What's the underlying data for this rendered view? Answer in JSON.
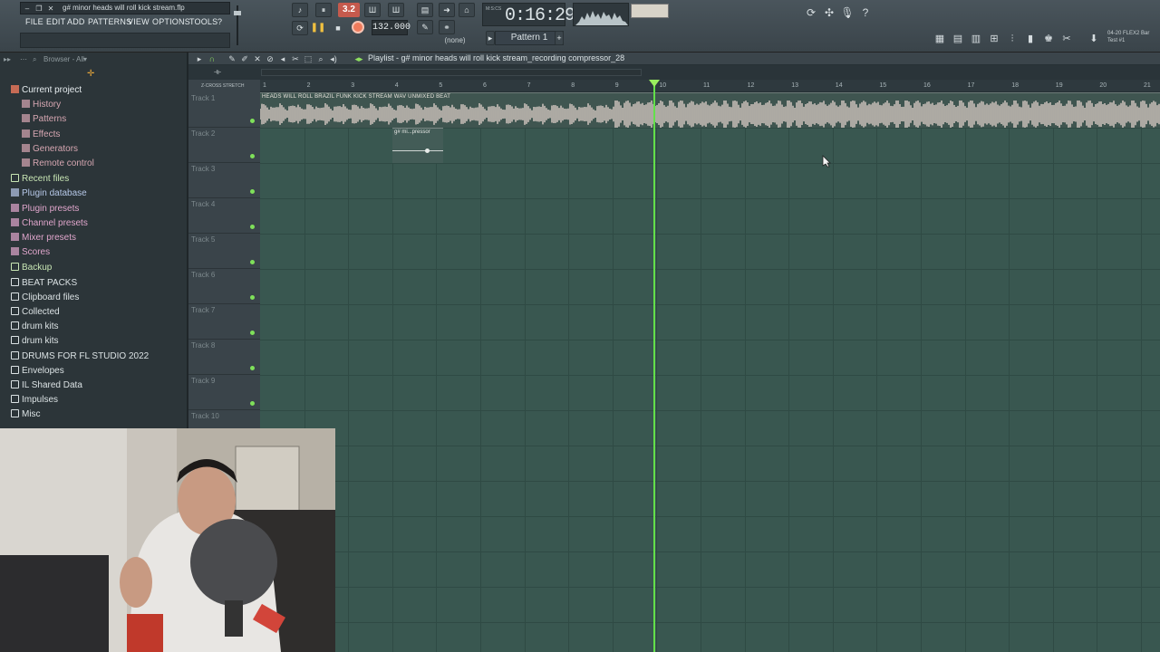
{
  "window": {
    "title": "g# minor heads will roll kick stream.flp"
  },
  "menu": [
    "FILE",
    "EDIT",
    "ADD",
    "PATTERNS",
    "VIEW",
    "OPTIONS",
    "TOOLS",
    "?"
  ],
  "transport": {
    "pat_song": "3.2",
    "tempo": "132.000",
    "time": "0:16:29",
    "time_unit": "M:S:CS",
    "pattern": "Pattern 1",
    "none_label": "(none)"
  },
  "flex": {
    "line1": "04-20 FLEX2 Bar",
    "line2": "Test #1"
  },
  "browser": {
    "header": "Browser - All",
    "items": [
      {
        "label": "Current project",
        "color": "#e7edf0",
        "icon": "project-icon"
      },
      {
        "label": "History",
        "color": "#d7a7b2",
        "icon": "history-icon"
      },
      {
        "label": "Patterns",
        "color": "#d7a7b2",
        "icon": "patterns-icon"
      },
      {
        "label": "Effects",
        "color": "#d7a7b2",
        "icon": "effects-icon"
      },
      {
        "label": "Generators",
        "color": "#d7a7b2",
        "icon": "generators-icon"
      },
      {
        "label": "Remote control",
        "color": "#d7a7b2",
        "icon": "remote-icon"
      },
      {
        "label": "Recent files",
        "color": "#c8e6b4",
        "icon": "folder-icon"
      },
      {
        "label": "Plugin database",
        "color": "#b6c8e8",
        "icon": "plugin-db-icon"
      },
      {
        "label": "Plugin presets",
        "color": "#e0a6cc",
        "icon": "plugin-presets-icon"
      },
      {
        "label": "Channel presets",
        "color": "#e0a6cc",
        "icon": "channel-presets-icon"
      },
      {
        "label": "Mixer presets",
        "color": "#e0a6cc",
        "icon": "mixer-presets-icon"
      },
      {
        "label": "Scores",
        "color": "#e0a6cc",
        "icon": "scores-icon"
      },
      {
        "label": "Backup",
        "color": "#c8e6b4",
        "icon": "folder-icon"
      },
      {
        "label": "BEAT PACKS",
        "color": "#dbe2e4",
        "icon": "folder-icon"
      },
      {
        "label": "Clipboard files",
        "color": "#dbe2e4",
        "icon": "folder-icon"
      },
      {
        "label": "Collected",
        "color": "#dbe2e4",
        "icon": "folder-icon"
      },
      {
        "label": "drum kits",
        "color": "#dbe2e4",
        "icon": "folder-icon"
      },
      {
        "label": "drum kits",
        "color": "#dbe2e4",
        "icon": "folder-icon"
      },
      {
        "label": "DRUMS FOR FL STUDIO 2022",
        "color": "#dbe2e4",
        "icon": "folder-icon"
      },
      {
        "label": "Envelopes",
        "color": "#dbe2e4",
        "icon": "folder-icon"
      },
      {
        "label": "IL Shared Data",
        "color": "#dbe2e4",
        "icon": "folder-icon"
      },
      {
        "label": "Impulses",
        "color": "#dbe2e4",
        "icon": "folder-icon"
      },
      {
        "label": "Misc",
        "color": "#dbe2e4",
        "icon": "folder-icon"
      }
    ]
  },
  "playlist": {
    "title": "Playlist - g# minor heads will roll kick stream_recording compressor_28",
    "mini_labels": "Z-CROSS    STRETCH",
    "ruler": [
      "1",
      "2",
      "3",
      "4",
      "5",
      "6",
      "7",
      "8",
      "9",
      "10",
      "11",
      "12",
      "13",
      "14",
      "15",
      "16",
      "17",
      "18",
      "19",
      "20",
      "21"
    ],
    "tracks": [
      "Track 1",
      "Track 2",
      "Track 3",
      "Track 4",
      "Track 5",
      "Track 6",
      "Track 7",
      "Track 8",
      "Track 9",
      "Track 10"
    ],
    "audio_clip_label": "HEADS WILL ROLL BRAZIL FUNK KICK STREAM WAV UNMIXED BEAT",
    "automation_clip_label": "g# mi...pressor"
  },
  "colors": {
    "grid": "#395750",
    "playhead": "#63e04a",
    "record": "#ef7b5c",
    "pat_song": "#c55a4d"
  }
}
